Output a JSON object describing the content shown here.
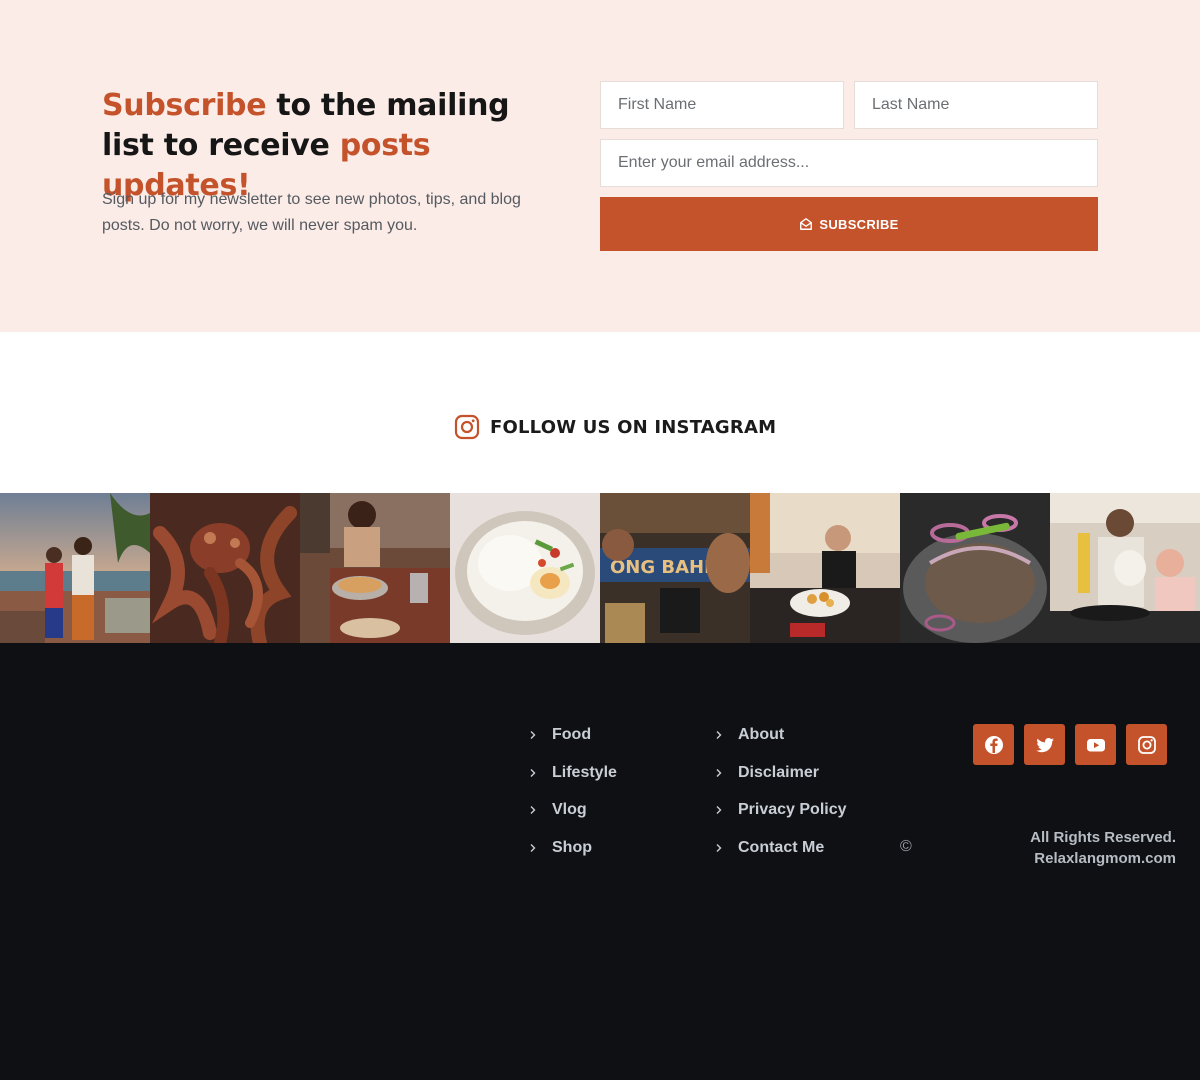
{
  "colors": {
    "accent": "#c4522a",
    "subscribe_bg": "#fbece8",
    "footer_bg": "#0f1013"
  },
  "subscribe": {
    "heading": {
      "part1_accent": "Subscribe",
      "part2": " to the mailing list to receive ",
      "part3_accent": "posts updates!"
    },
    "description": "Sign up for my newsletter to see new photos, tips, and blog posts. Do not worry, we will never spam you.",
    "first_name_placeholder": "First Name",
    "last_name_placeholder": "Last Name",
    "email_placeholder": "Enter your email address...",
    "button_label": "SUBSCRIBE",
    "button_icon": "envelope-open-icon"
  },
  "instagram": {
    "title": "FOLLOW US ON INSTAGRAM",
    "icon": "instagram-icon",
    "photos": [
      {
        "name": "beach-family-photo"
      },
      {
        "name": "grilled-octopus-photo"
      },
      {
        "name": "restaurant-hotpot-photo"
      },
      {
        "name": "rice-egg-dish-photo"
      },
      {
        "name": "restaurant-selfie-photo"
      },
      {
        "name": "diner-woman-photo"
      },
      {
        "name": "sizzling-sisig-photo"
      },
      {
        "name": "kitchen-cooking-photo"
      }
    ]
  },
  "footer": {
    "nav_col1": [
      "Food",
      "Lifestyle",
      "Vlog",
      "Shop"
    ],
    "nav_col2": [
      "About",
      "Disclaimer",
      "Privacy Policy",
      "Contact Me"
    ],
    "copyright_symbol": "©",
    "social": [
      "facebook-icon",
      "twitter-icon",
      "youtube-icon",
      "instagram-icon"
    ],
    "rights_line1": "All Rights Reserved.",
    "rights_line2": "Relaxlangmom.com"
  }
}
